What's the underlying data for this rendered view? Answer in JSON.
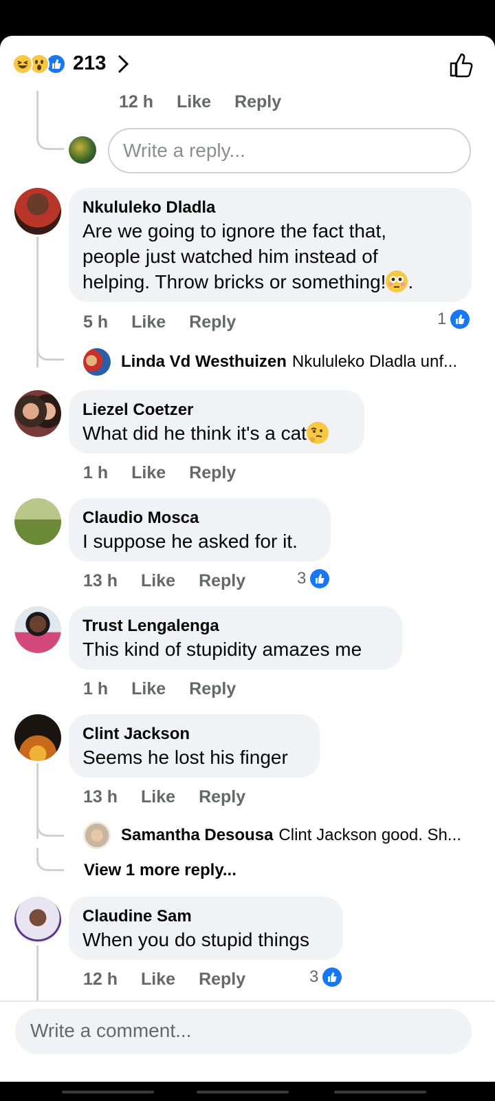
{
  "header": {
    "reaction_icons": [
      "haha-icon",
      "wow-icon",
      "like-icon"
    ],
    "reaction_count": "213"
  },
  "top_thread": {
    "time": "12 h",
    "like_label": "Like",
    "reply_label": "Reply",
    "reply_placeholder": "Write a reply..."
  },
  "comments": [
    {
      "author": "Nkululeko Dladla",
      "text_line1": "Are we going to ignore the fact that,",
      "text_line2": "people just watched him instead of",
      "text_line3": "helping. Throw bricks or something!",
      "text_tail": ".",
      "time": "5 h",
      "like_label": "Like",
      "reply_label": "Reply",
      "like_count": "1",
      "reply_preview": {
        "author": "Linda Vd Westhuizen",
        "text": "Nkululeko Dladla unf..."
      }
    },
    {
      "author": "Liezel Coetzer",
      "text": "What did he think it's a cat",
      "time": "1 h",
      "like_label": "Like",
      "reply_label": "Reply"
    },
    {
      "author": "Claudio Mosca",
      "text": "I suppose he asked for it.",
      "time": "13 h",
      "like_label": "Like",
      "reply_label": "Reply",
      "like_count": "3"
    },
    {
      "author": "Trust Lengalenga",
      "text": "This kind of stupidity amazes me",
      "time": "1 h",
      "like_label": "Like",
      "reply_label": "Reply"
    },
    {
      "author": "Clint Jackson",
      "text": "Seems he lost his finger",
      "time": "13 h",
      "like_label": "Like",
      "reply_label": "Reply",
      "reply_preview": {
        "author": "Samantha Desousa",
        "text": "Clint Jackson good. Sh..."
      },
      "view_more": "View 1 more reply..."
    },
    {
      "author": "Claudine Sam",
      "text": "When you do stupid things",
      "time": "12 h",
      "like_label": "Like",
      "reply_label": "Reply",
      "like_count": "3"
    }
  ],
  "composer": {
    "placeholder": "Write a comment..."
  },
  "colors": {
    "accent": "#1877f2",
    "bubble": "#f0f2f5",
    "muted": "#65676b",
    "line": "#ced0d4"
  }
}
